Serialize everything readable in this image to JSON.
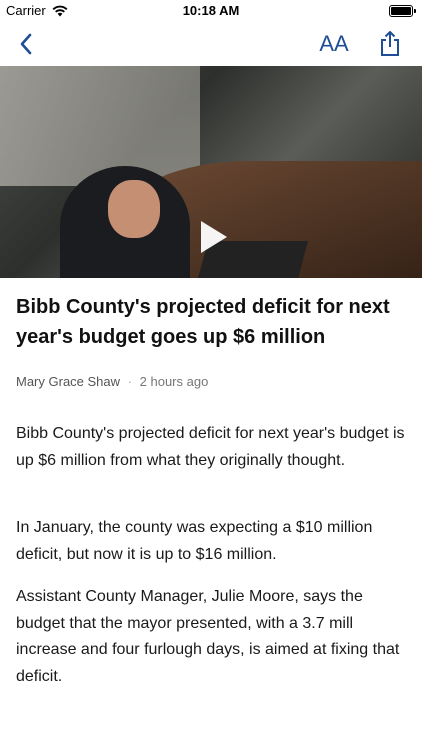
{
  "status_bar": {
    "carrier": "Carrier",
    "time": "10:18 AM"
  },
  "nav": {
    "text_size_label": "AA",
    "icons": [
      "chevron-left-icon",
      "text-size-icon",
      "share-icon"
    ],
    "accent_color": "#1f4e97"
  },
  "video": {
    "icons": [
      "play-icon"
    ]
  },
  "article": {
    "headline": "Bibb County's projected deficit for next year's budget goes up $6 million",
    "author": "Mary Grace Shaw",
    "separator": "·",
    "timestamp": "2 hours ago",
    "paragraphs": [
      "Bibb County's projected deficit for next year's budget is up $6 million from what they originally thought.",
      "In January, the county was expecting a $10 million deficit, but now it is up to $16 million.",
      "Assistant County Manager, Julie Moore, says the budget that the mayor presented, with a 3.7 mill increase and four furlough days, is aimed at fixing that deficit."
    ]
  }
}
